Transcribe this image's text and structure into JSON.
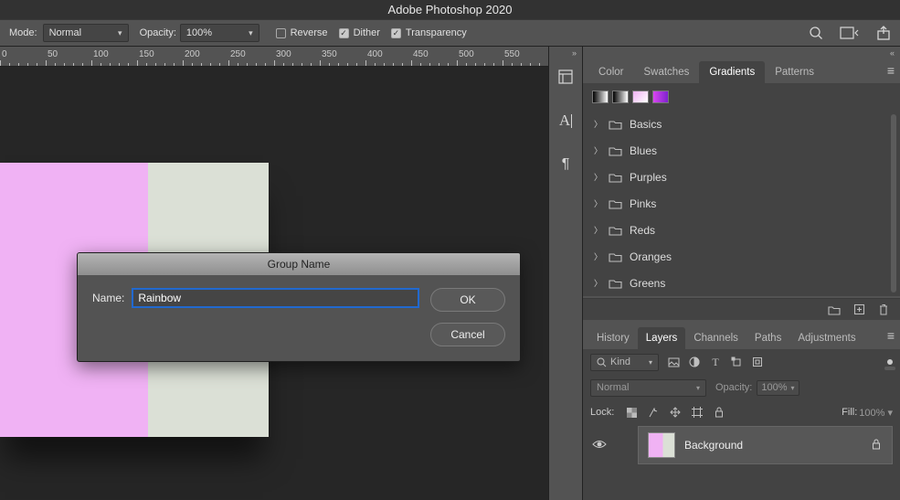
{
  "app_title": "Adobe Photoshop 2020",
  "options": {
    "mode_label": "Mode:",
    "mode_value": "Normal",
    "opacity_label": "Opacity:",
    "opacity_value": "100%",
    "reverse_label": "Reverse",
    "reverse_checked": false,
    "dither_label": "Dither",
    "dither_checked": true,
    "transparency_label": "Transparency",
    "transparency_checked": true
  },
  "ruler_ticks": [
    "0",
    "50",
    "100",
    "150",
    "200",
    "250",
    "300",
    "350",
    "400",
    "450",
    "500",
    "550"
  ],
  "dialog": {
    "title": "Group Name",
    "name_label": "Name:",
    "name_value": "Rainbow",
    "ok": "OK",
    "cancel": "Cancel"
  },
  "swatches_panel": {
    "tabs": {
      "color": "Color",
      "swatches": "Swatches",
      "gradients": "Gradients",
      "patterns": "Patterns"
    },
    "active_tab": "Gradients",
    "folders": [
      "Basics",
      "Blues",
      "Purples",
      "Pinks",
      "Reds",
      "Oranges",
      "Greens"
    ]
  },
  "layers_panel": {
    "tabs": {
      "history": "History",
      "layers": "Layers",
      "channels": "Channels",
      "paths": "Paths",
      "adjustments": "Adjustments"
    },
    "active_tab": "Layers",
    "filter_kind_label": "Kind",
    "blend_mode": "Normal",
    "opacity_label": "Opacity:",
    "opacity_value": "100%",
    "lock_label": "Lock:",
    "fill_label": "Fill:",
    "fill_value": "100%",
    "layer_name": "Background"
  }
}
